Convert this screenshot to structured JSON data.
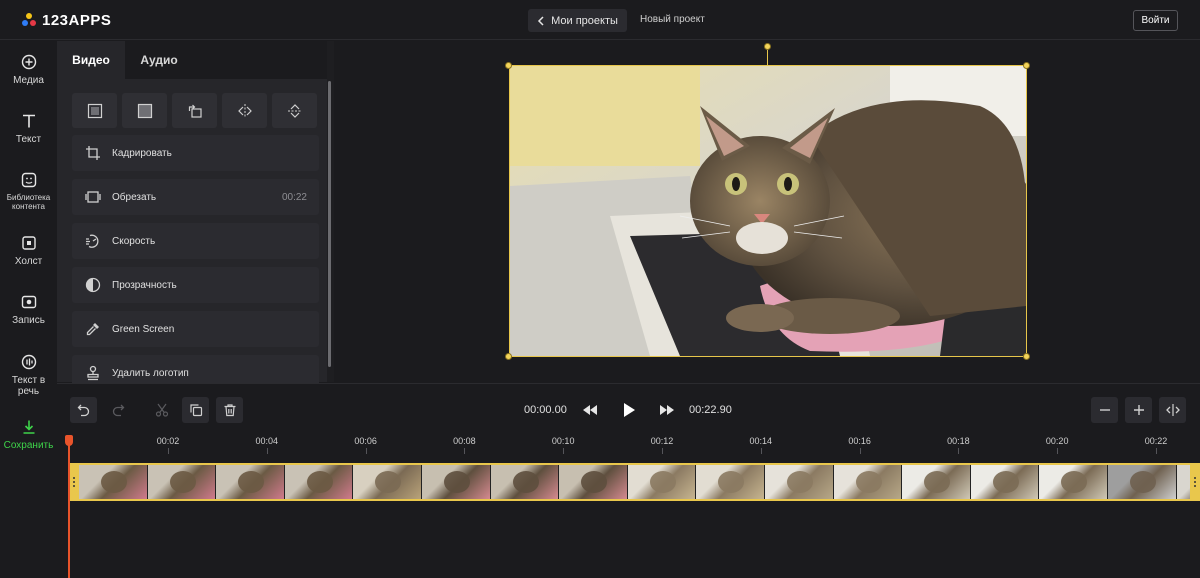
{
  "app": {
    "logo_text": "123APPS",
    "back_label": "Мои проекты",
    "project_title": "Новый проект",
    "login_label": "Войти"
  },
  "colors": {
    "accent_yellow": "#e9c74c",
    "save_green": "#3ed34a",
    "playhead": "#e9542b",
    "logo_dot_1": "#f5c518",
    "logo_dot_2": "#2f7cf6",
    "logo_dot_3": "#e63946"
  },
  "sidebar": {
    "items": [
      {
        "label": "Медиа",
        "icon": "plus-circle-icon"
      },
      {
        "label": "Текст",
        "icon": "text-t-icon"
      },
      {
        "label": "Библиотека контента",
        "icon": "sticker-icon"
      },
      {
        "label": "Холст",
        "icon": "canvas-icon"
      },
      {
        "label": "Запись",
        "icon": "record-icon"
      },
      {
        "label": "Текст в речь",
        "icon": "text-to-speech-icon"
      },
      {
        "label": "Сохранить",
        "icon": "download-icon"
      }
    ]
  },
  "panel": {
    "tabs": [
      {
        "label": "Видео",
        "active": true
      },
      {
        "label": "Аудио",
        "active": false
      }
    ],
    "tools": [
      "fit-frame-icon",
      "fill-frame-icon",
      "rotate-icon",
      "flip-horizontal-icon",
      "flip-vertical-icon"
    ],
    "actions": [
      {
        "label": "Кадрировать",
        "icon": "crop-icon",
        "value": ""
      },
      {
        "label": "Обрезать",
        "icon": "trim-icon",
        "value": "00:22"
      },
      {
        "label": "Скорость",
        "icon": "speed-icon",
        "value": ""
      },
      {
        "label": "Прозрачность",
        "icon": "opacity-icon",
        "value": ""
      },
      {
        "label": "Green Screen",
        "icon": "eyedropper-icon",
        "value": ""
      },
      {
        "label": "Удалить логотип",
        "icon": "stamp-icon",
        "value": ""
      }
    ]
  },
  "controls": {
    "current_time": "00:00.00",
    "total_time": "00:22.90"
  },
  "timeline": {
    "ticks": [
      "00:02",
      "00:04",
      "00:06",
      "00:08",
      "00:10",
      "00:12",
      "00:14",
      "00:16",
      "00:18",
      "00:20",
      "00:22"
    ]
  }
}
